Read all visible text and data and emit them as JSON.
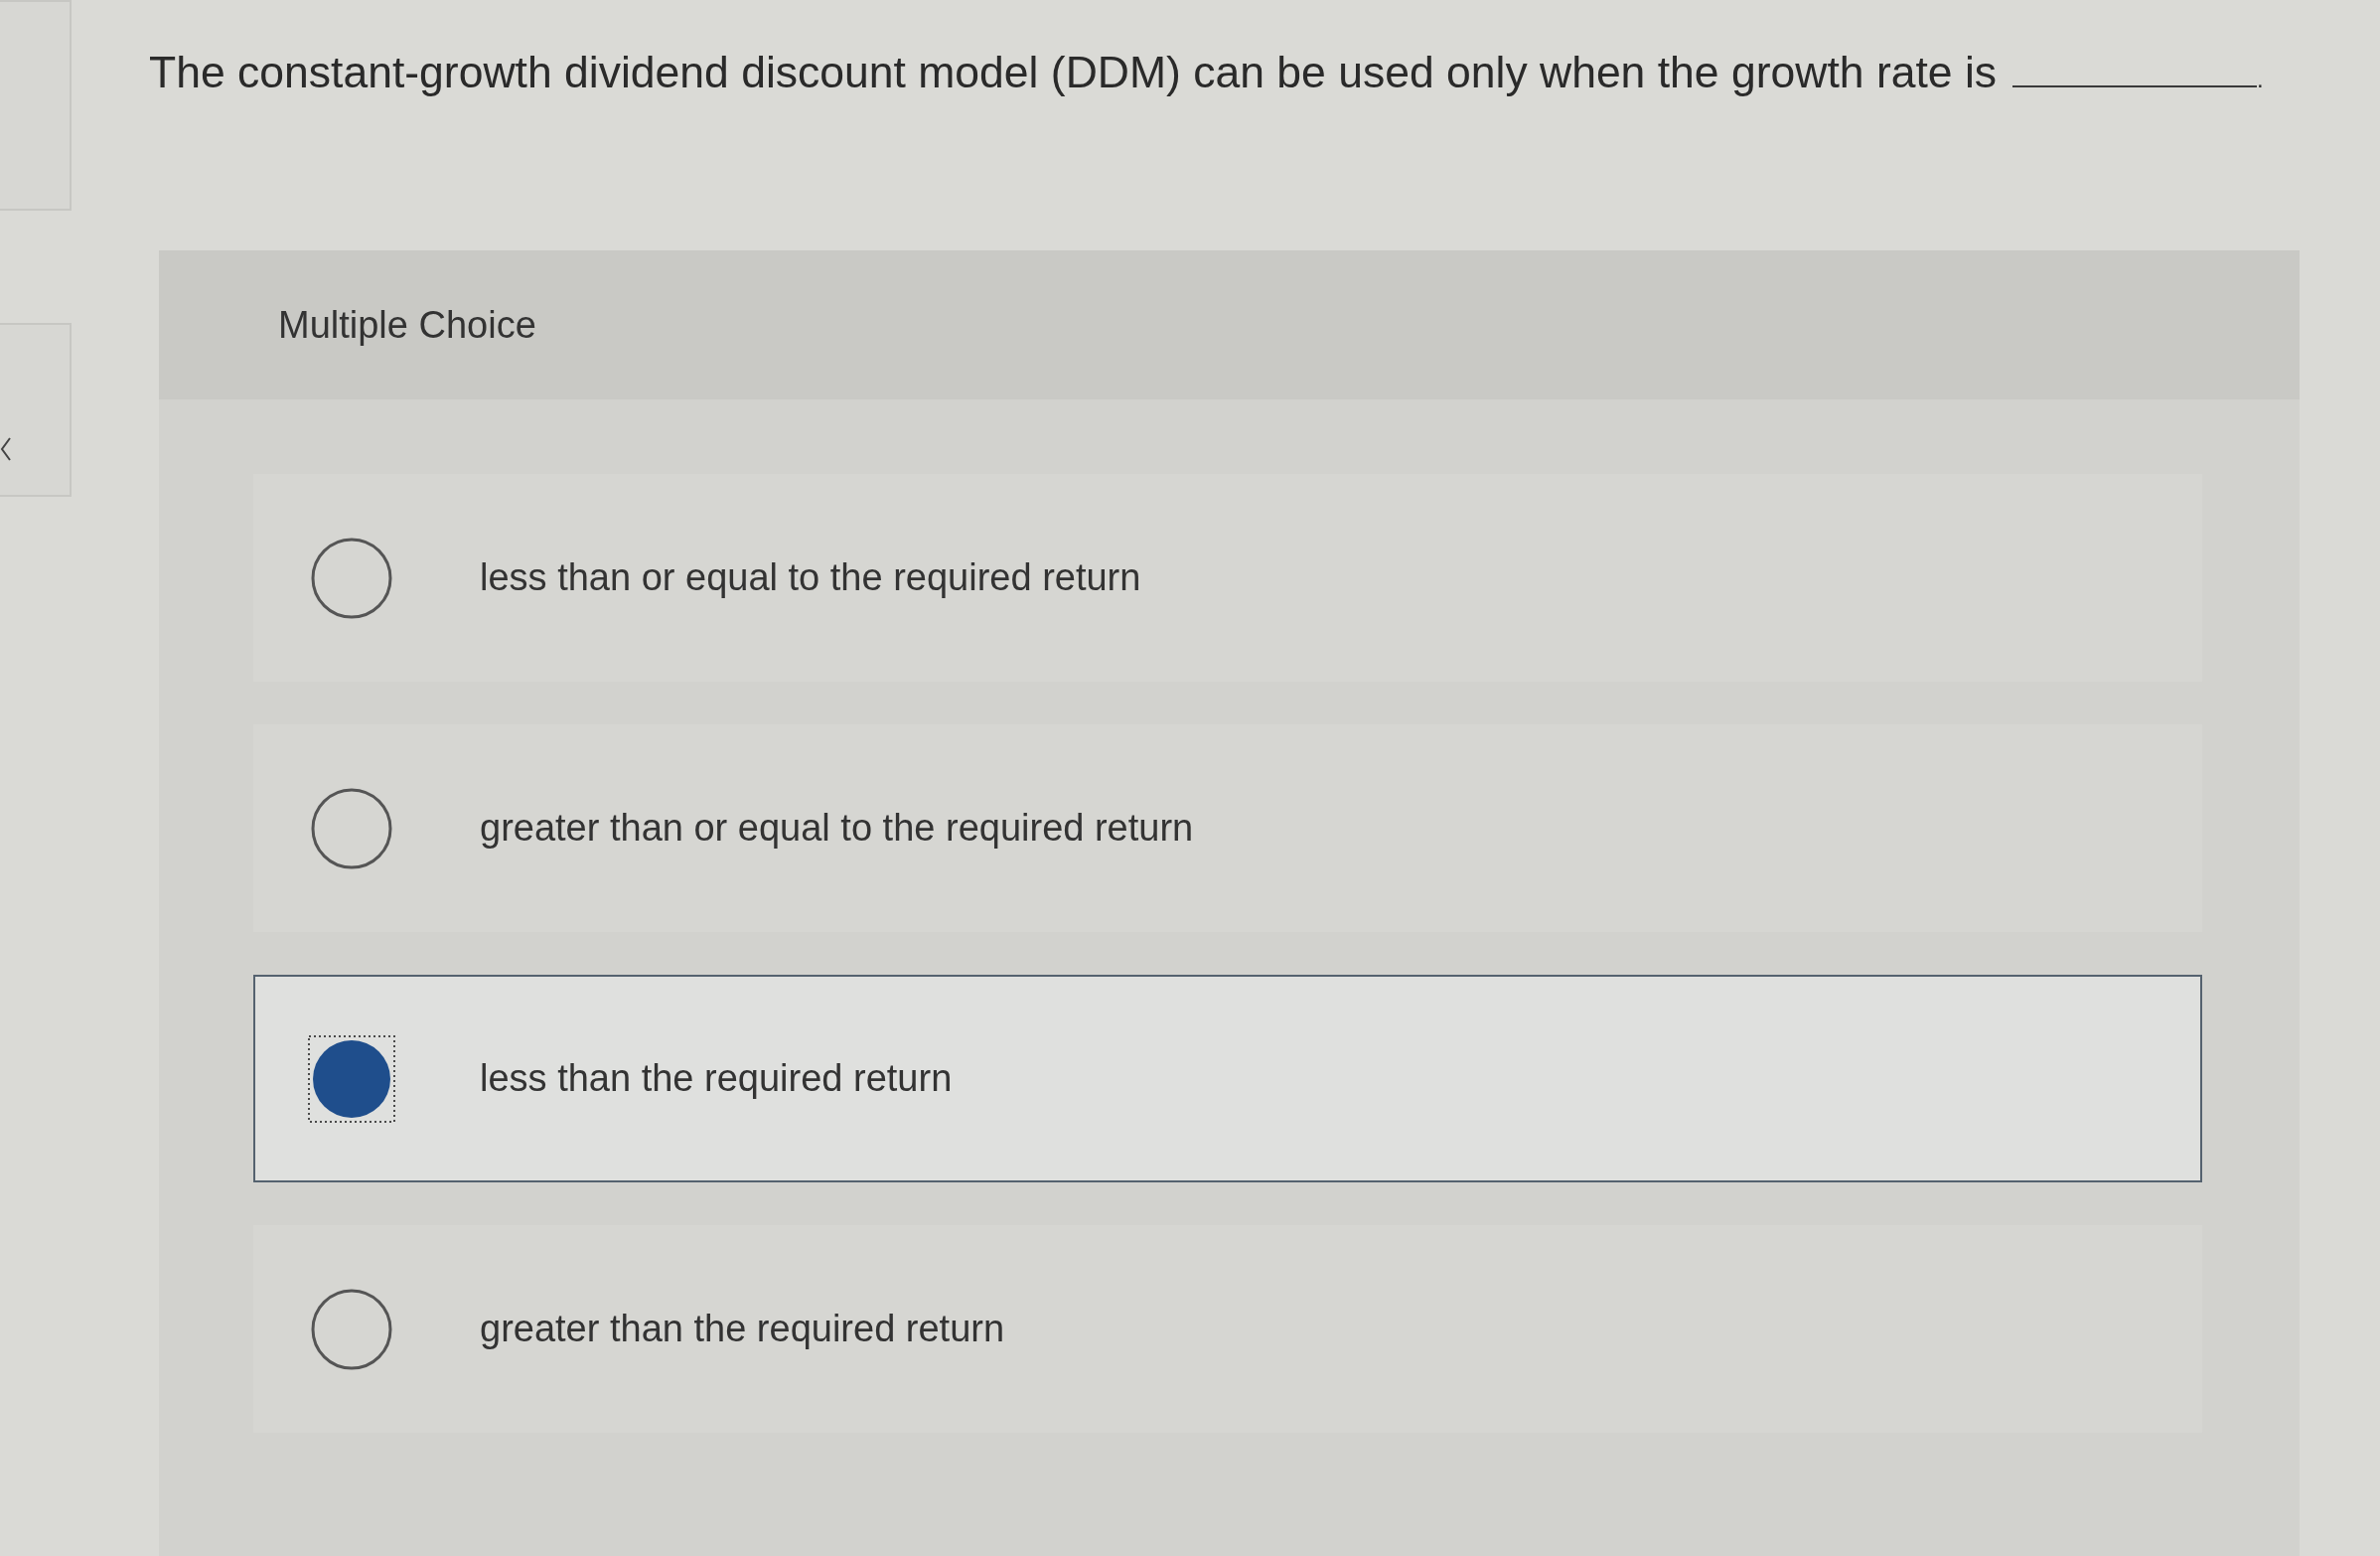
{
  "question": {
    "text": "The constant-growth dividend discount model (DDM) can be used only when the growth rate is",
    "after_blank": "."
  },
  "panel": {
    "title": "Multiple Choice"
  },
  "options": [
    {
      "label": "less than or equal to the required return",
      "selected": false
    },
    {
      "label": "greater than or equal to the required return",
      "selected": false
    },
    {
      "label": "less than the required return",
      "selected": true
    },
    {
      "label": "greater than the required return",
      "selected": false
    }
  ]
}
